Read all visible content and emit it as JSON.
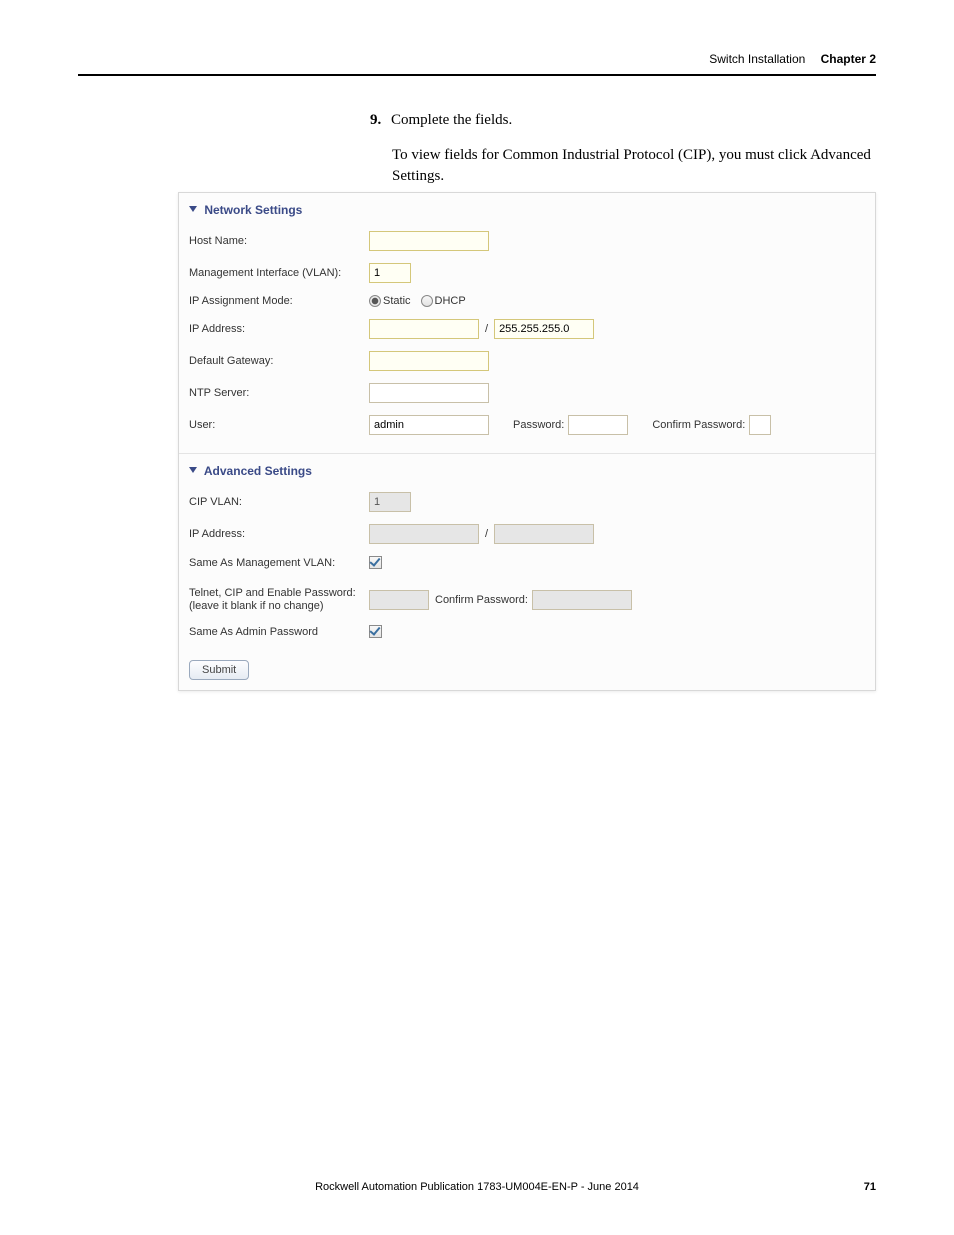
{
  "header": {
    "section": "Switch Installation",
    "chapter": "Chapter 2"
  },
  "step": {
    "num": "9.",
    "text": "Complete the fields.",
    "note": "To view fields for Common Industrial Protocol (CIP), you must click Advanced Settings."
  },
  "network": {
    "title": "Network Settings",
    "host_name_lbl": "Host Name:",
    "host_name_val": "",
    "vlan_lbl": "Management Interface (VLAN):",
    "vlan_val": "1",
    "ip_mode_lbl": "IP Assignment Mode:",
    "ip_mode_static": "Static",
    "ip_mode_dhcp": "DHCP",
    "ip_addr_lbl": "IP Address:",
    "ip_addr_val": "",
    "subnet_val": "255.255.255.0",
    "gateway_lbl": "Default Gateway:",
    "gateway_val": "",
    "ntp_lbl": "NTP Server:",
    "ntp_val": "",
    "user_lbl": "User:",
    "user_val": "admin",
    "pwd_lbl": "Password:",
    "pwd_val": "",
    "cpwd_lbl": "Confirm Password:",
    "cpwd_val": ""
  },
  "advanced": {
    "title": "Advanced Settings",
    "cip_vlan_lbl": "CIP VLAN:",
    "cip_vlan_val": "1",
    "ip_addr_lbl": "IP Address:",
    "ip_addr_val": "",
    "subnet_val": "",
    "same_mgmt_lbl": "Same As Management VLAN:",
    "tcep_lbl_1": "Telnet, CIP and Enable Password:",
    "tcep_lbl_2": "(leave it blank if no change)",
    "tcep_val": "",
    "tcep_cpwd_lbl": "Confirm Password:",
    "tcep_cpwd_val": "",
    "same_admin_lbl": "Same As Admin Password"
  },
  "submit_label": "Submit",
  "footer": {
    "pub": "Rockwell Automation Publication 1783-UM004E-EN-P - June 2014",
    "page": "71"
  }
}
